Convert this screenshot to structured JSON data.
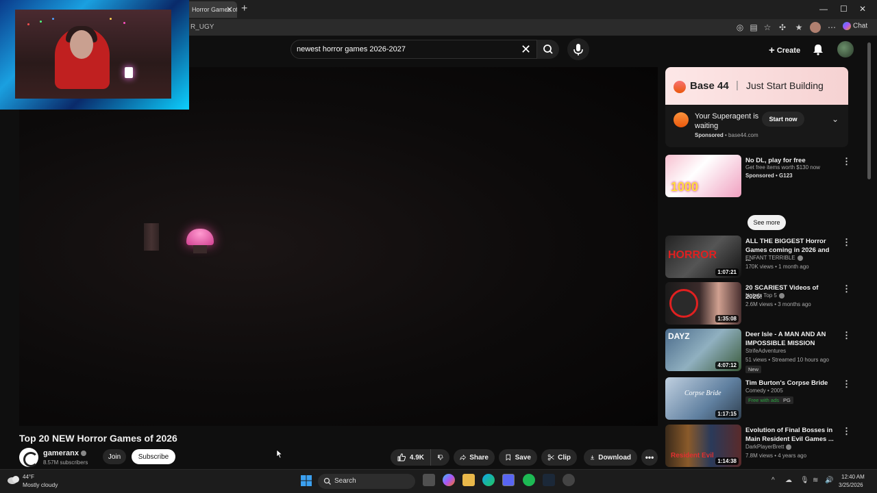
{
  "browser": {
    "tab_title": "Horror Games of",
    "url_fragment": "R_UGY",
    "chat_label": "Chat"
  },
  "header": {
    "search_query": "newest horror games 2026-2027",
    "create_label": "Create"
  },
  "video": {
    "title": "Top 20 NEW Horror Games of 2026",
    "channel": "gameranx",
    "subscribers": "8.57M subscribers",
    "join_label": "Join",
    "subscribe_label": "Subscribe",
    "likes": "4.9K",
    "share_label": "Share",
    "save_label": "Save",
    "clip_label": "Clip",
    "download_label": "Download"
  },
  "ad": {
    "brand": "Base 44",
    "separator": "|",
    "slogan": "Just Start Building",
    "title": "Your Superagent is waiting",
    "sponsored": "Sponsored",
    "domain": "• base44.com",
    "cta": "Start now"
  },
  "recommendations": [
    {
      "title": "No DL, play for free",
      "channel": "Get free items worth $130 now",
      "meta": "Sponsored • G123",
      "duration": "",
      "badge": "",
      "see_more": "See more"
    },
    {
      "title": "ALL THE BIGGEST Horror Games coming in 2026 and ...",
      "channel": "ENFANT TERRIBLE",
      "meta": "170K views • 1 month ago",
      "duration": "1:07:21",
      "badge": ""
    },
    {
      "title": "20 SCARIEST Videos of 2025!",
      "channel": "Nuke's Top 5",
      "meta": "2.6M views • 3 months ago",
      "duration": "1:35:08",
      "badge": ""
    },
    {
      "title": "Deer Isle - A MAN AND AN IMPOSSIBLE MISSION",
      "channel": "StrifeAdventures",
      "meta": "51 views • Streamed 10 hours ago",
      "duration": "4:07:12",
      "badge": "New"
    },
    {
      "title": "Tim Burton's Corpse Bride",
      "channel": "Comedy • 2005",
      "meta": "Free with ads",
      "duration": "1:17:15",
      "badge": "PG"
    },
    {
      "title": "Evolution of Final Bosses in Main Resident Evil Games ...",
      "channel": "DarkPlayerBrett",
      "meta": "7.8M views • 4 years ago",
      "duration": "1:14:38",
      "badge": ""
    }
  ],
  "taskbar": {
    "temp": "44°F",
    "condition": "Mostly cloudy",
    "search_label": "Search",
    "time": "12:40 AM",
    "date": "3/25/2026"
  },
  "colors": {
    "background": "#0f0f0f",
    "ad_banner": "#fde7e7",
    "free_with_ads": "#2ba640"
  }
}
